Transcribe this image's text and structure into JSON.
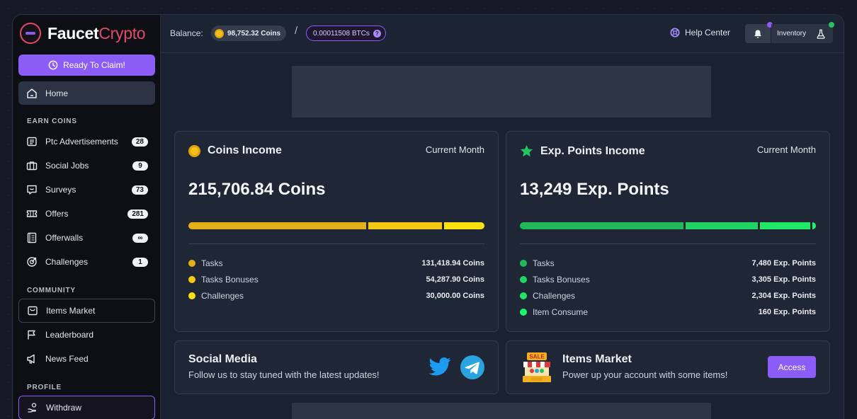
{
  "brand": {
    "name_primary": "Faucet",
    "name_accent": "Crypto"
  },
  "sidebar": {
    "claim_label": "Ready To Claim!",
    "home_label": "Home",
    "section_earn": "EARN COINS",
    "earn_items": [
      {
        "label": "Ptc Advertisements",
        "badge": "28",
        "icon": "ptc-icon"
      },
      {
        "label": "Social Jobs",
        "badge": "9",
        "icon": "briefcase-icon"
      },
      {
        "label": "Surveys",
        "badge": "73",
        "icon": "survey-icon"
      },
      {
        "label": "Offers",
        "badge": "281",
        "icon": "ticket-icon"
      },
      {
        "label": "Offerwalls",
        "badge": "∞",
        "icon": "offerwall-icon"
      },
      {
        "label": "Challenges",
        "badge": "1",
        "icon": "challenge-icon"
      }
    ],
    "section_community": "COMMUNITY",
    "community_items": [
      {
        "label": "Items Market",
        "icon": "market-icon"
      },
      {
        "label": "Leaderboard",
        "icon": "flag-icon"
      },
      {
        "label": "News Feed",
        "icon": "megaphone-icon"
      }
    ],
    "section_profile": "PROFILE",
    "profile_items": [
      {
        "label": "Withdraw",
        "icon": "withdraw-icon"
      }
    ]
  },
  "topbar": {
    "balance_label": "Balance:",
    "coins_balance": "98,752.32 Coins",
    "separator": "/",
    "btc_balance": "0.00011508 BTCs",
    "help_label": "Help Center",
    "inventory_label": "Inventory"
  },
  "coins_card": {
    "title": "Coins Income",
    "period": "Current Month",
    "total": "215,706.84 Coins",
    "rows": [
      {
        "name": "Tasks",
        "value": "131,418.94 Coins",
        "color": "#e3b01a",
        "amount": 131418.94
      },
      {
        "name": "Tasks Bonuses",
        "value": "54,287.90 Coins",
        "color": "#f5c816",
        "amount": 54287.9
      },
      {
        "name": "Challenges",
        "value": "30,000.00 Coins",
        "color": "#fde00f",
        "amount": 30000.0
      }
    ]
  },
  "exp_card": {
    "title": "Exp. Points Income",
    "period": "Current Month",
    "total": "13,249 Exp. Points",
    "rows": [
      {
        "name": "Tasks",
        "value": "7,480 Exp. Points",
        "color": "#22b859",
        "amount": 7480
      },
      {
        "name": "Tasks Bonuses",
        "value": "3,305 Exp. Points",
        "color": "#20d463",
        "amount": 3305
      },
      {
        "name": "Challenges",
        "value": "2,304 Exp. Points",
        "color": "#1ee866",
        "amount": 2304
      },
      {
        "name": "Item Consume",
        "value": "160 Exp. Points",
        "color": "#1df76b",
        "amount": 160
      }
    ]
  },
  "social_card": {
    "title": "Social Media",
    "subtitle": "Follow us to stay tuned with the latest updates!"
  },
  "market_card": {
    "title": "Items Market",
    "subtitle": "Power up your account with some items!",
    "button": "Access",
    "sale_label": "SALE"
  },
  "colors": {
    "accent": "#8b5cf6",
    "coin": "#f6c21a",
    "exp": "#22c55e"
  }
}
